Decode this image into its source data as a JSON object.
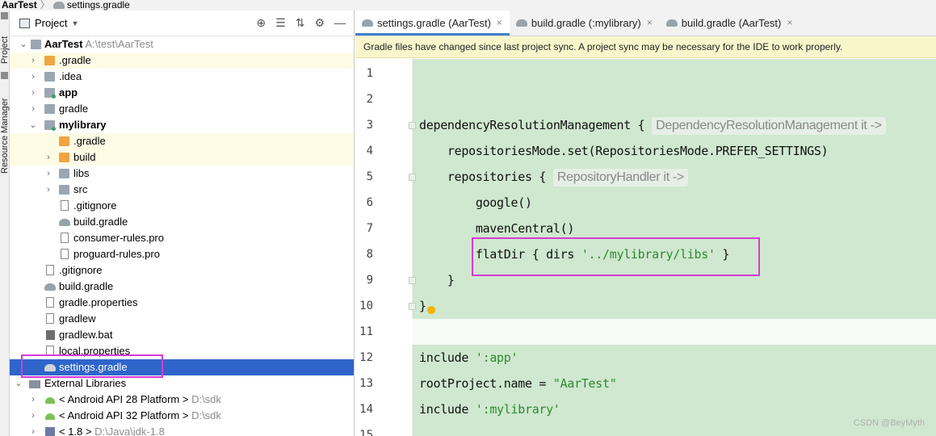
{
  "breadcrumb": {
    "root": "AarTest",
    "separator": "〉",
    "file": "settings.gradle"
  },
  "stripe": {
    "project_tab": "Project",
    "resource_tab": "Resource Manager"
  },
  "panel": {
    "title": "Project",
    "tools": [
      "⊕",
      "☰",
      "⇅",
      "⚙",
      "—"
    ]
  },
  "tree": [
    {
      "label": "AarTest",
      "path": "A:\\test\\AarTest"
    },
    {
      "label": ".gradle"
    },
    {
      "label": ".idea"
    },
    {
      "label": "app"
    },
    {
      "label": "gradle"
    },
    {
      "label": "mylibrary"
    },
    {
      "label": ".gradle"
    },
    {
      "label": "build"
    },
    {
      "label": "libs"
    },
    {
      "label": "src"
    },
    {
      "label": ".gitignore"
    },
    {
      "label": "build.gradle"
    },
    {
      "label": "consumer-rules.pro"
    },
    {
      "label": "proguard-rules.pro"
    },
    {
      "label": ".gitignore"
    },
    {
      "label": "build.gradle"
    },
    {
      "label": "gradle.properties"
    },
    {
      "label": "gradlew"
    },
    {
      "label": "gradlew.bat"
    },
    {
      "label": "local.properties"
    },
    {
      "label": "settings.gradle"
    },
    {
      "label": "External Libraries"
    },
    {
      "label": "< Android API 28 Platform >",
      "path": "D:\\sdk"
    },
    {
      "label": "< Android API 32 Platform >",
      "path": "D:\\sdk"
    },
    {
      "label": "< 1.8 >",
      "path": "D:\\Java\\jdk-1.8"
    }
  ],
  "tabs": [
    {
      "label": "settings.gradle (AarTest)",
      "close": "×"
    },
    {
      "label": "build.gradle (:mylibrary)",
      "close": "×"
    },
    {
      "label": "build.gradle (AarTest)",
      "close": "×"
    }
  ],
  "notice": "Gradle files have changed since last project sync. A project sync may be necessary for the IDE to work properly.",
  "code": {
    "line_numbers": [
      "1",
      "2",
      "3",
      "4",
      "5",
      "6",
      "7",
      "8",
      "9",
      "10",
      "11",
      "12",
      "13",
      "14",
      "15"
    ],
    "l3a": "dependencyResolutionManagement { ",
    "l3hint": "DependencyResolutionManagement it ->",
    "l4": "    repositoriesMode.set(RepositoriesMode.PREFER_SETTINGS)",
    "l5a": "    repositories { ",
    "l5hint": "RepositoryHandler it ->",
    "l6": "        google()",
    "l7": "        mavenCentral()",
    "l8a": "        flatDir { dirs ",
    "l8s": "'../mylibrary/libs'",
    "l8b": " }",
    "l9": "    }",
    "l10": "}",
    "l12a": "include ",
    "l12s": "':app'",
    "l13a": "rootProject.name = ",
    "l13s": "\"AarTest\"",
    "l14a": "include ",
    "l14s": "':mylibrary'"
  },
  "watermark": "CSDN @BeyMyth"
}
